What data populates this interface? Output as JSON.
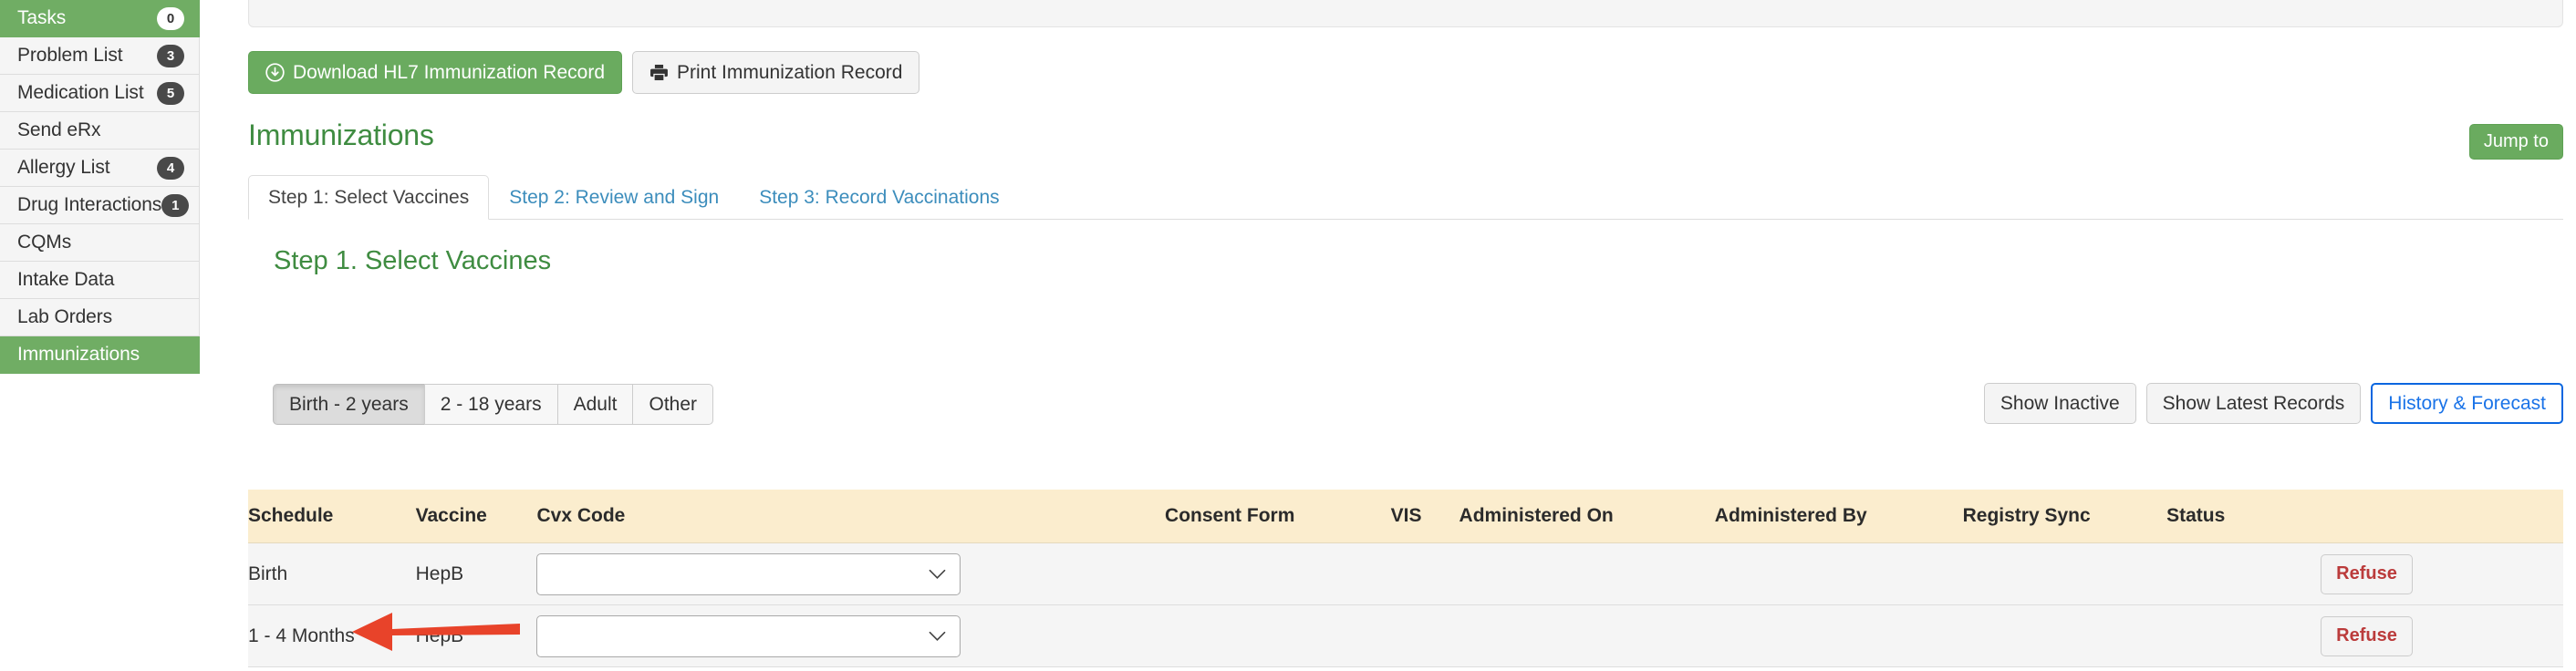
{
  "sidebar": {
    "items": [
      {
        "label": "Tasks",
        "badge": "0",
        "active": true,
        "name": "tasks"
      },
      {
        "label": "Problem List",
        "badge": "3",
        "active": false,
        "name": "problem-list"
      },
      {
        "label": "Medication List",
        "badge": "5",
        "active": false,
        "name": "medication-list"
      },
      {
        "label": "Send eRx",
        "badge": "",
        "active": false,
        "name": "send-erx"
      },
      {
        "label": "Allergy List",
        "badge": "4",
        "active": false,
        "name": "allergy-list"
      },
      {
        "label": "Drug Interactions",
        "badge": "1",
        "active": false,
        "name": "drug-interactions"
      },
      {
        "label": "CQMs",
        "badge": "",
        "active": false,
        "name": "cqms"
      },
      {
        "label": "Intake Data",
        "badge": "",
        "active": false,
        "name": "intake-data"
      },
      {
        "label": "Lab Orders",
        "badge": "",
        "active": false,
        "name": "lab-orders"
      },
      {
        "label": "Immunizations",
        "badge": "",
        "active": true,
        "name": "immunizations"
      }
    ]
  },
  "toolbar": {
    "download_label": "Download HL7 Immunization Record",
    "download_icon": "download-circle-icon",
    "print_label": "Print Immunization Record",
    "print_icon": "printer-icon"
  },
  "page": {
    "title": "Immunizations",
    "jump_to_label": "Jump to"
  },
  "tabs": [
    {
      "label": "Step 1: Select Vaccines",
      "active": true,
      "name": "tab-step-1"
    },
    {
      "label": "Step 2: Review and Sign",
      "active": false,
      "name": "tab-step-2"
    },
    {
      "label": "Step 3: Record Vaccinations",
      "active": false,
      "name": "tab-step-3"
    }
  ],
  "step": {
    "heading": "Step 1. Select Vaccines",
    "age_filters": [
      {
        "label": "Birth - 2 years",
        "active": true,
        "name": "age-filter-birth-2-years"
      },
      {
        "label": "2 - 18 years",
        "active": false,
        "name": "age-filter-2-18-years"
      },
      {
        "label": "Adult",
        "active": false,
        "name": "age-filter-adult"
      },
      {
        "label": "Other",
        "active": false,
        "name": "age-filter-other"
      }
    ],
    "right_tools": [
      {
        "label": "Show Inactive",
        "style": "default",
        "name": "show-inactive-button"
      },
      {
        "label": "Show Latest Records",
        "style": "default",
        "name": "show-latest-records-button"
      },
      {
        "label": "History & Forecast",
        "style": "primary-outline",
        "name": "history-forecast-button"
      }
    ]
  },
  "table": {
    "columns": [
      "Schedule",
      "Vaccine",
      "Cvx Code",
      "Consent Form",
      "VIS",
      "Administered On",
      "Administered By",
      "Registry Sync",
      "Status"
    ],
    "rows": [
      {
        "schedule": "Birth",
        "schedule_tone": "blue",
        "vaccine": "HepB",
        "cvx_value": "",
        "cvx_placeholder": "",
        "consent_form": "",
        "vis": "",
        "administered_on": "",
        "administered_by": "",
        "registry_sync": "",
        "status": "",
        "action_label": "Refuse"
      },
      {
        "schedule": "1 - 4 Months",
        "schedule_tone": "peach",
        "vaccine": "HepB",
        "cvx_value": "",
        "cvx_placeholder": "",
        "consent_form": "",
        "vis": "",
        "administered_on": "",
        "administered_by": "",
        "registry_sync": "",
        "status": "",
        "action_label": "Refuse"
      }
    ]
  },
  "annotation": {
    "arrow_color": "#e8432a",
    "arrow_target": "sidebar-item-immunizations"
  },
  "colors": {
    "brand_green": "#6aab5f",
    "title_green": "#3f8c41",
    "link_blue": "#3c8dbc",
    "table_header_bg": "#fbedce",
    "refuse_red": "#bb3b3b",
    "outline_blue": "#1a73e8"
  }
}
